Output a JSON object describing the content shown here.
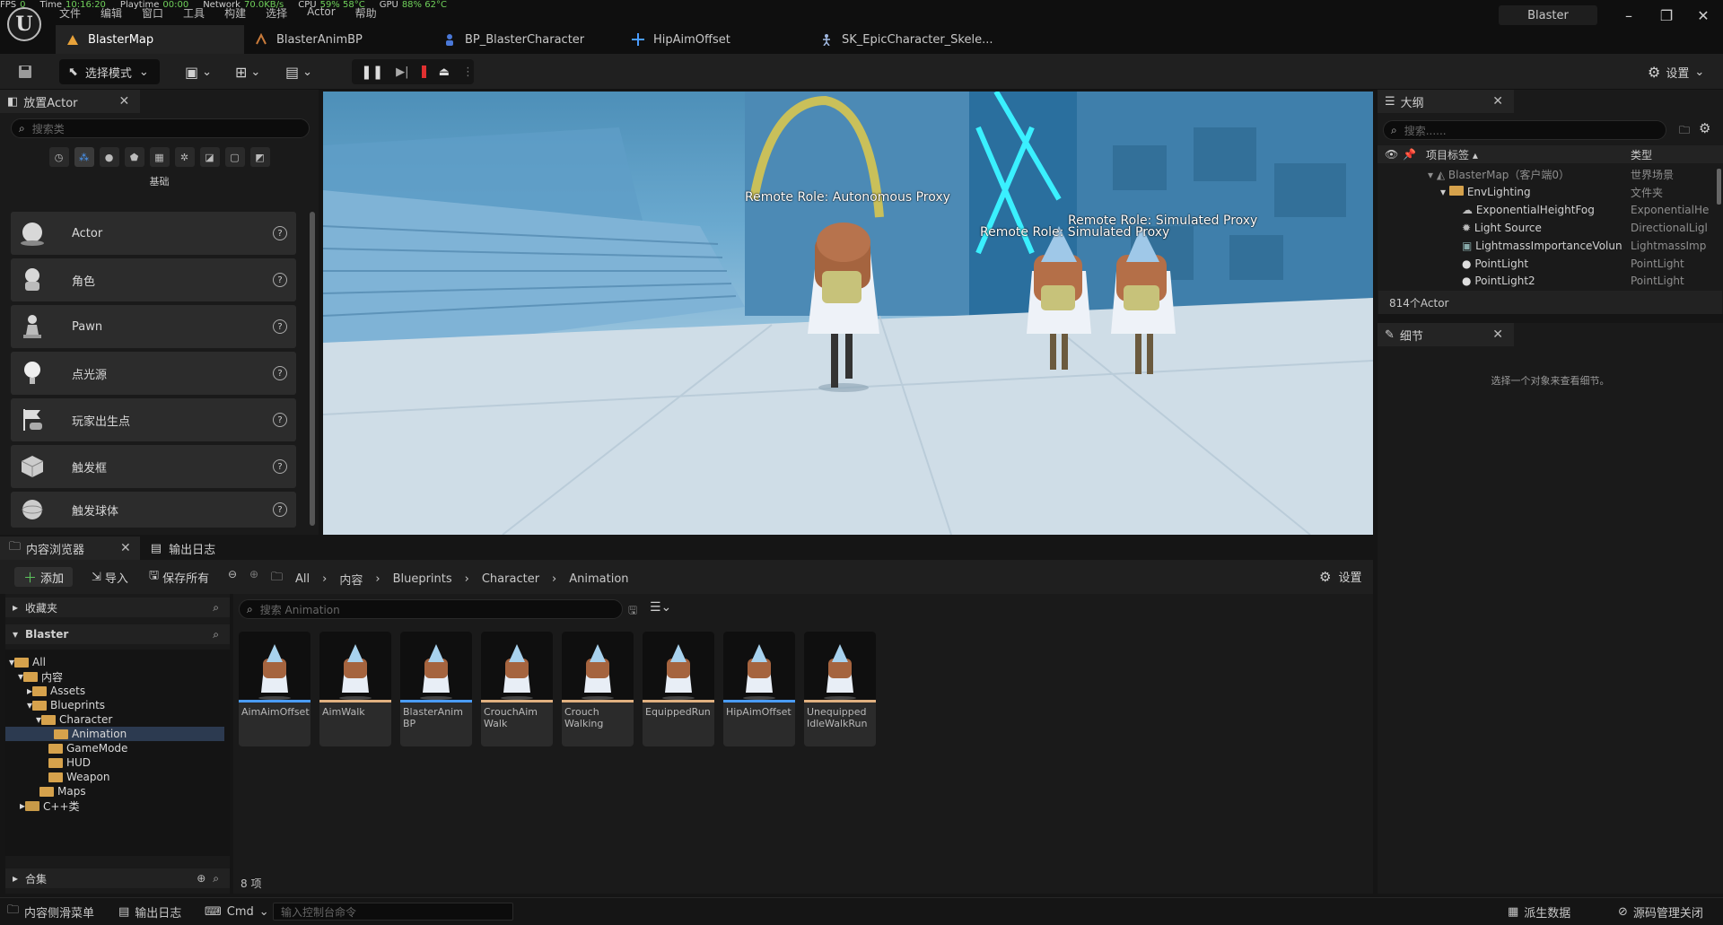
{
  "stats": [
    {
      "label": "FPS",
      "value": "0"
    },
    {
      "label": "Time",
      "value": "10:16:20"
    },
    {
      "label": "Playtime",
      "value": "00:00"
    },
    {
      "label": "Network",
      "value": "70.0KB/s"
    },
    {
      "label": "CPU",
      "value": "59% 58°C"
    },
    {
      "label": "GPU",
      "value": "88% 62°C"
    }
  ],
  "menus": [
    "文件",
    "编辑",
    "窗口",
    "工具",
    "构建",
    "选择",
    "Actor",
    "帮助"
  ],
  "tabs": [
    {
      "label": "BlasterMap",
      "icon": "map-icon"
    },
    {
      "label": "BlasterAnimBP",
      "icon": "anim-blueprint-icon"
    },
    {
      "label": "BP_BlasterCharacter",
      "icon": "character-icon"
    },
    {
      "label": "HipAimOffset",
      "icon": "aim-offset-icon"
    },
    {
      "label": "SK_EpicCharacter_Skele...",
      "icon": "skeleton-icon"
    }
  ],
  "window_title": "Blaster",
  "toolbar": {
    "mode_label": "选择模式",
    "settings_label": "设置"
  },
  "place_actors": {
    "tab_label": "放置Actor",
    "search_placeholder": "搜索类",
    "category_label": "基础",
    "items": [
      {
        "label": "Actor",
        "icon": "actor-sphere-icon"
      },
      {
        "label": "角色",
        "icon": "character-figure-icon"
      },
      {
        "label": "Pawn",
        "icon": "pawn-icon"
      },
      {
        "label": "点光源",
        "icon": "point-light-icon"
      },
      {
        "label": "玩家出生点",
        "icon": "player-start-icon"
      },
      {
        "label": "触发框",
        "icon": "trigger-box-icon"
      },
      {
        "label": "触发球体",
        "icon": "trigger-sphere-icon"
      }
    ]
  },
  "viewport": {
    "labels": [
      "Remote Role: Autonomous Proxy",
      "Remote Role: Simulated Proxy",
      "Remote Role: Simulated Proxy"
    ]
  },
  "outliner": {
    "tab_label": "大纲",
    "search_placeholder": "搜索......",
    "col_label": "项目标签",
    "col_type": "类型",
    "rows": [
      {
        "name": "BlasterMap（客户端0）",
        "type": "世界场景"
      },
      {
        "name": "EnvLighting",
        "type": "文件夹"
      },
      {
        "name": "ExponentialHeightFog",
        "type": "ExponentialHe"
      },
      {
        "name": "Light Source",
        "type": "DirectionalLigl"
      },
      {
        "name": "LightmassImportanceVolun",
        "type": "LightmassImp"
      },
      {
        "name": "PointLight",
        "type": "PointLight"
      },
      {
        "name": "PointLight2",
        "type": "PointLight"
      }
    ],
    "count": "814个Actor"
  },
  "details": {
    "tab_label": "细节",
    "empty_text": "选择一个对象来查看细节。"
  },
  "content_browser": {
    "tab_label": "内容浏览器",
    "log_tab_label": "输出日志",
    "add_label": "添加",
    "import_label": "导入",
    "save_all_label": "保存所有",
    "breadcrumbs": [
      "All",
      "内容",
      "Blueprints",
      "Character",
      "Animation"
    ],
    "settings_label": "设置",
    "favorites_label": "收藏夹",
    "project_label": "Blaster",
    "collections_label": "合集",
    "search_placeholder": "搜索 Animation",
    "item_count": "8 项",
    "tree": [
      {
        "label": "All",
        "depth": 0
      },
      {
        "label": "内容",
        "depth": 1
      },
      {
        "label": "Assets",
        "depth": 2
      },
      {
        "label": "Blueprints",
        "depth": 2
      },
      {
        "label": "Character",
        "depth": 3
      },
      {
        "label": "Animation",
        "depth": 4
      },
      {
        "label": "GameMode",
        "depth": 3
      },
      {
        "label": "HUD",
        "depth": 3
      },
      {
        "label": "Weapon",
        "depth": 3
      },
      {
        "label": "Maps",
        "depth": 2
      },
      {
        "label": "C++类",
        "depth": 1
      }
    ],
    "assets": [
      {
        "label": "AimAimOffset",
        "bar": "#4a9cff"
      },
      {
        "label": "AimWalk",
        "bar": "#e0b080"
      },
      {
        "label": "BlasterAnim BP",
        "bar": "#4a9cff"
      },
      {
        "label": "CrouchAim Walk",
        "bar": "#e0b080"
      },
      {
        "label": "Crouch Walking",
        "bar": "#e0b080"
      },
      {
        "label": "EquippedRun",
        "bar": "#e0b080"
      },
      {
        "label": "HipAimOffset",
        "bar": "#4a9cff"
      },
      {
        "label": "Unequipped IdleWalkRun",
        "bar": "#e0b080"
      }
    ]
  },
  "statusbar": {
    "drawer_label": "内容侧滑菜单",
    "log_label": "输出日志",
    "cmd_label": "Cmd",
    "cmd_placeholder": "输入控制台命令",
    "derived_label": "派生数据",
    "source_label": "源码管理关闭"
  }
}
